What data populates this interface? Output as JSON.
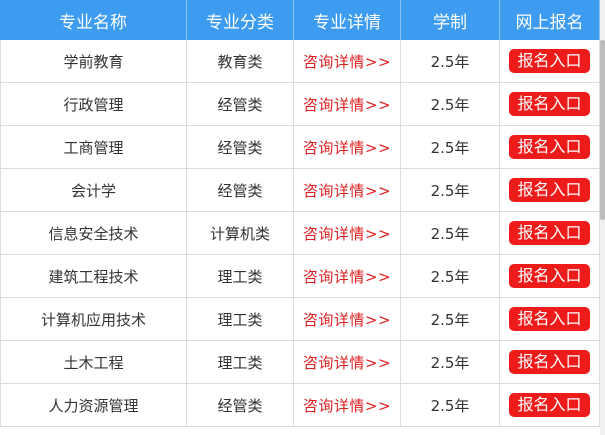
{
  "table": {
    "headers": [
      "专业名称",
      "专业分类",
      "专业详情",
      "学制",
      "网上报名"
    ],
    "rows": [
      {
        "name": "学前教育",
        "category": "教育类",
        "detail": "咨询详情>>",
        "duration": "2.5年",
        "signup": "报名入口"
      },
      {
        "name": "行政管理",
        "category": "经管类",
        "detail": "咨询详情>>",
        "duration": "2.5年",
        "signup": "报名入口"
      },
      {
        "name": "工商管理",
        "category": "经管类",
        "detail": "咨询详情>>",
        "duration": "2.5年",
        "signup": "报名入口"
      },
      {
        "name": "会计学",
        "category": "经管类",
        "detail": "咨询详情>>",
        "duration": "2.5年",
        "signup": "报名入口"
      },
      {
        "name": "信息安全技术",
        "category": "计算机类",
        "detail": "咨询详情>>",
        "duration": "2.5年",
        "signup": "报名入口"
      },
      {
        "name": "建筑工程技术",
        "category": "理工类",
        "detail": "咨询详情>>",
        "duration": "2.5年",
        "signup": "报名入口"
      },
      {
        "name": "计算机应用技术",
        "category": "理工类",
        "detail": "咨询详情>>",
        "duration": "2.5年",
        "signup": "报名入口"
      },
      {
        "name": "土木工程",
        "category": "理工类",
        "detail": "咨询详情>>",
        "duration": "2.5年",
        "signup": "报名入口"
      },
      {
        "name": "人力资源管理",
        "category": "经管类",
        "detail": "咨询详情>>",
        "duration": "2.5年",
        "signup": "报名入口"
      }
    ]
  },
  "colors": {
    "header_bg": "#3d9bf0",
    "link": "#e02020",
    "button_bg": "#ee1b1b"
  }
}
